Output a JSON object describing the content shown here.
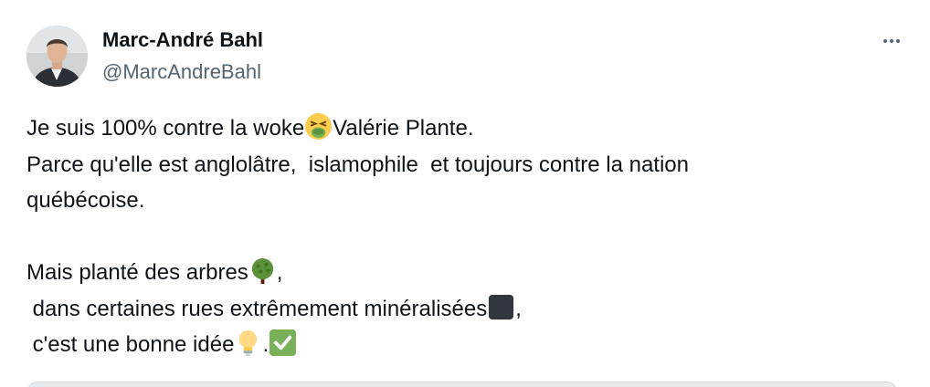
{
  "author": {
    "name": "Marc-André Bahl",
    "handle": "@MarcAndreBahl"
  },
  "tweet": {
    "line1_a": "Je suis 100% contre la woke",
    "line1_b": "Valérie Plante.",
    "line2": "Parce qu'elle est anglolâtre,  islamophile  et toujours contre la nation",
    "line3": "québécoise.",
    "line5_a": "Mais planté des arbres",
    "line5_b": ",",
    "line6_a": " dans certaines rues extrêmement minéralisées",
    "line6_b": ",",
    "line7_a": " c'est une bonne idée",
    "line7_b": "."
  },
  "icons": {
    "more": "more-options-icon",
    "emoji1": "nauseated-face-emoji",
    "emoji2": "tree-emoji",
    "emoji3": "black-square-emoji",
    "emoji4": "light-bulb-emoji",
    "emoji5": "check-mark-emoji"
  },
  "colors": {
    "text": "#0f1419",
    "secondary": "#536471",
    "check": "#78b159"
  }
}
